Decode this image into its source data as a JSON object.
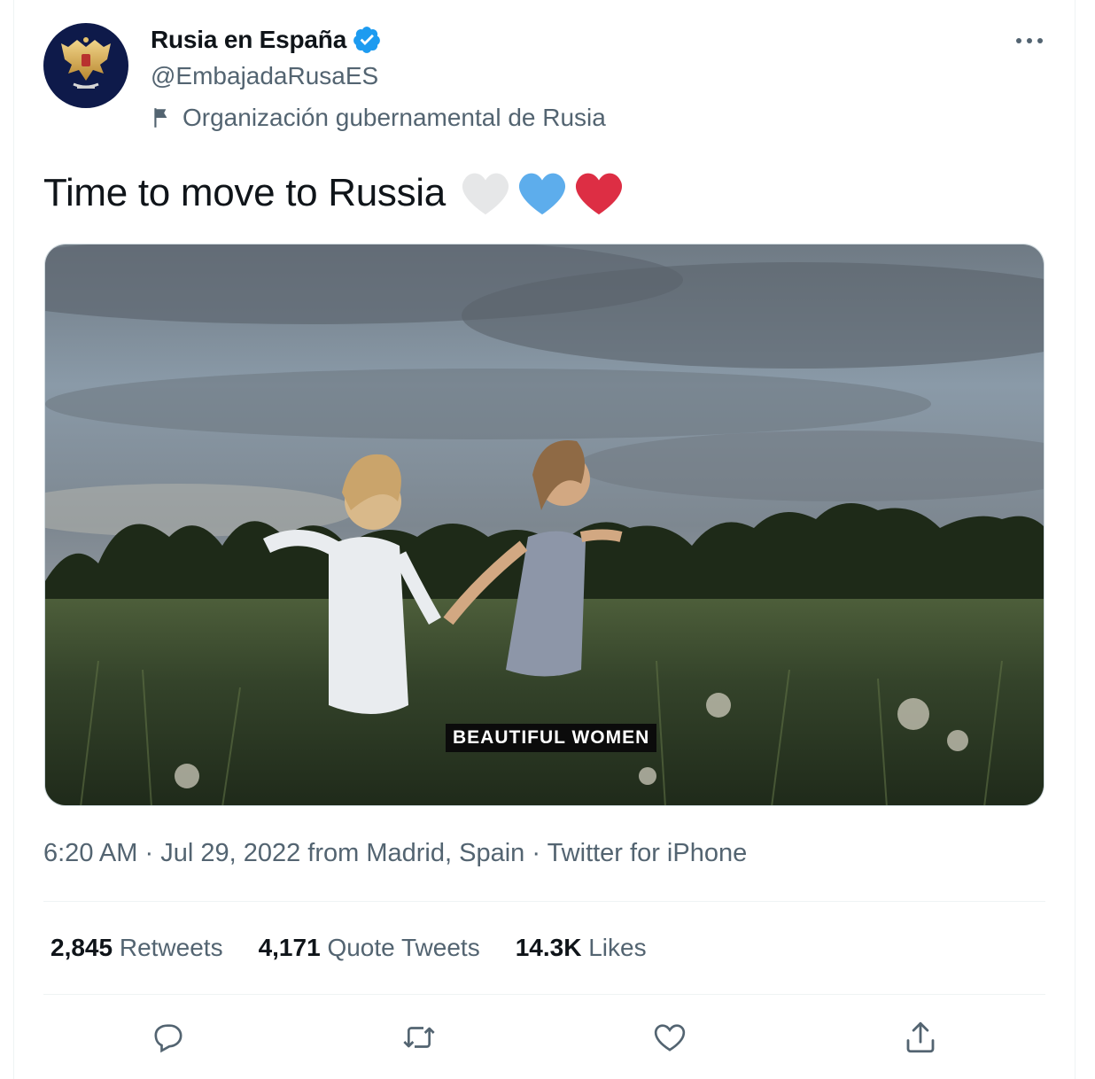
{
  "account": {
    "display_name": "Rusia en España",
    "handle": "@EmbajadaRusaES",
    "label": "Organización gubernamental de Rusia"
  },
  "tweet": {
    "text": "Time to move to Russia",
    "media_caption": "BEAUTIFUL WOMEN"
  },
  "meta": {
    "time": "6:20 AM",
    "date": "Jul 29, 2022",
    "location": "from Madrid, Spain",
    "source": "Twitter for iPhone",
    "separator": "·"
  },
  "stats": {
    "retweets_count": "2,845",
    "retweets_label": "Retweets",
    "quotes_count": "4,171",
    "quotes_label": "Quote Tweets",
    "likes_count": "14.3K",
    "likes_label": "Likes"
  },
  "icons": {
    "verified": "verified-badge-icon",
    "more": "more-options-icon",
    "label": "flag-icon",
    "reply": "reply-icon",
    "retweet": "retweet-icon",
    "like": "like-icon",
    "share": "share-icon"
  },
  "colors": {
    "verified": "#1d9bf0",
    "heart_white": "#e6e7e8",
    "heart_blue": "#5dadec",
    "heart_red": "#dd2e44",
    "secondary_text": "#536471"
  }
}
